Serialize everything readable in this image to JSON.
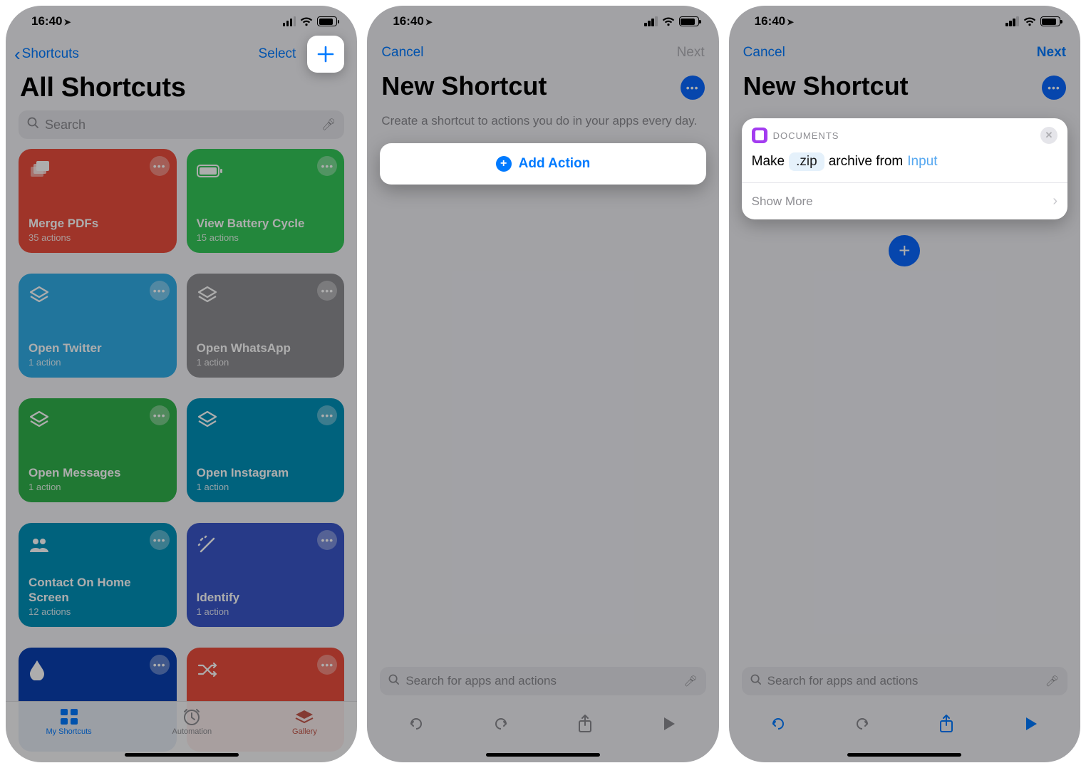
{
  "status": {
    "time": "16:40"
  },
  "screen1": {
    "back_label": "Shortcuts",
    "select_label": "Select",
    "title": "All Shortcuts",
    "search_placeholder": "Search",
    "tiles": [
      {
        "title": "Merge PDFs",
        "sub": "35 actions"
      },
      {
        "title": "View Battery Cycle",
        "sub": "15 actions"
      },
      {
        "title": "Open Twitter",
        "sub": "1 action"
      },
      {
        "title": "Open WhatsApp",
        "sub": "1 action"
      },
      {
        "title": "Open Messages",
        "sub": "1 action"
      },
      {
        "title": "Open Instagram",
        "sub": "1 action"
      },
      {
        "title": "Contact On Home Screen",
        "sub": "12 actions"
      },
      {
        "title": "Identify",
        "sub": "1 action"
      }
    ],
    "tabs": {
      "my": "My Shortcuts",
      "auto": "Automation",
      "gallery": "Gallery"
    }
  },
  "screen2": {
    "cancel": "Cancel",
    "next": "Next",
    "title": "New Shortcut",
    "subtext": "Create a shortcut to actions you do in your apps every day.",
    "add_action": "Add Action",
    "search_placeholder": "Search for apps and actions"
  },
  "screen3": {
    "cancel": "Cancel",
    "next": "Next",
    "title": "New Shortcut",
    "action": {
      "app": "DOCUMENTS",
      "word1": "Make",
      "pill": ".zip",
      "word2": "archive from",
      "ghost": "Input",
      "show_more": "Show More"
    },
    "search_placeholder": "Search for apps and actions"
  }
}
